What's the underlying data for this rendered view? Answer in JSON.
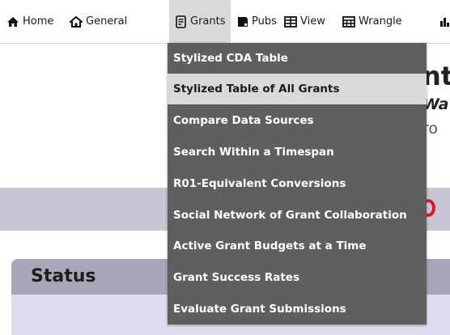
{
  "navbar": {
    "items": [
      {
        "label": "Home",
        "icon": "home-icon"
      },
      {
        "label": "General",
        "icon": "house-icon"
      },
      {
        "label": "Grants",
        "icon": "document-icon"
      },
      {
        "label": "Pubs",
        "icon": "book-icon"
      },
      {
        "label": "View",
        "icon": "table-icon"
      },
      {
        "label": "Wrangle",
        "icon": "grid-icon"
      }
    ],
    "active": "Grants"
  },
  "dropdown": {
    "items": [
      {
        "label": "Stylized CDA Table"
      },
      {
        "label": "Stylized Table of All Grants",
        "highlighted": true
      },
      {
        "label": "Compare Data Sources"
      },
      {
        "label": "Search Within a Timespan"
      },
      {
        "label": "R01-Equivalent Conversions"
      },
      {
        "label": "Social Network of Grant Collaboration"
      },
      {
        "label": "Active Grant Budgets at a Time"
      },
      {
        "label": "Grant Success Rates"
      },
      {
        "label": "Evaluate Grant Submissions"
      }
    ]
  },
  "page": {
    "heading_fragment": "nt",
    "sub1_fragment": "Wa",
    "sub2_fragment": "ro",
    "status_title": "Status"
  },
  "colors": {
    "menu_bg": "#5f5f5f",
    "menu_highlight": "#d9d9d9",
    "band": "#c7c7d3",
    "panel_header": "#a7a7b9",
    "panel_body": "#dcdcee",
    "accent_red": "#e8121a"
  }
}
